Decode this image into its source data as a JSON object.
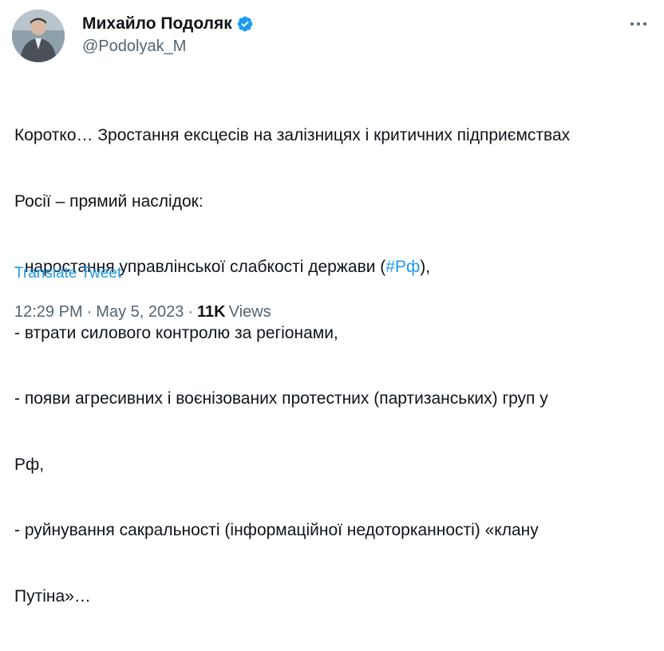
{
  "author": {
    "display_name": "Михайло Подоляк",
    "handle": "@Podolyak_M",
    "verified_color": "#1d9bf0"
  },
  "tweet": {
    "lines": [
      "Коротко… Зростання ексцесів на залізницях і критичних підприємствах",
      "Росії – прямий наслідок:",
      "- наростання управлінської слабкості держави (",
      "- втрати силового контролю за регіонами,",
      "- появи агресивних і воєнізованих протестних (партизанських) груп у",
      "Рф,",
      "- руйнування сакральності (інформаційної недоторканності) «клану",
      "Путіна»…"
    ],
    "hashtag": "#Рф",
    "line3_suffix": "),"
  },
  "translate_label": "Translate Tweet",
  "meta": {
    "time": "12:29 PM",
    "separator": "·",
    "date": "May 5, 2023",
    "views_count": "11K",
    "views_label": "Views"
  },
  "icons": {
    "verified": "verified-badge-icon",
    "more": "more-options-icon"
  }
}
